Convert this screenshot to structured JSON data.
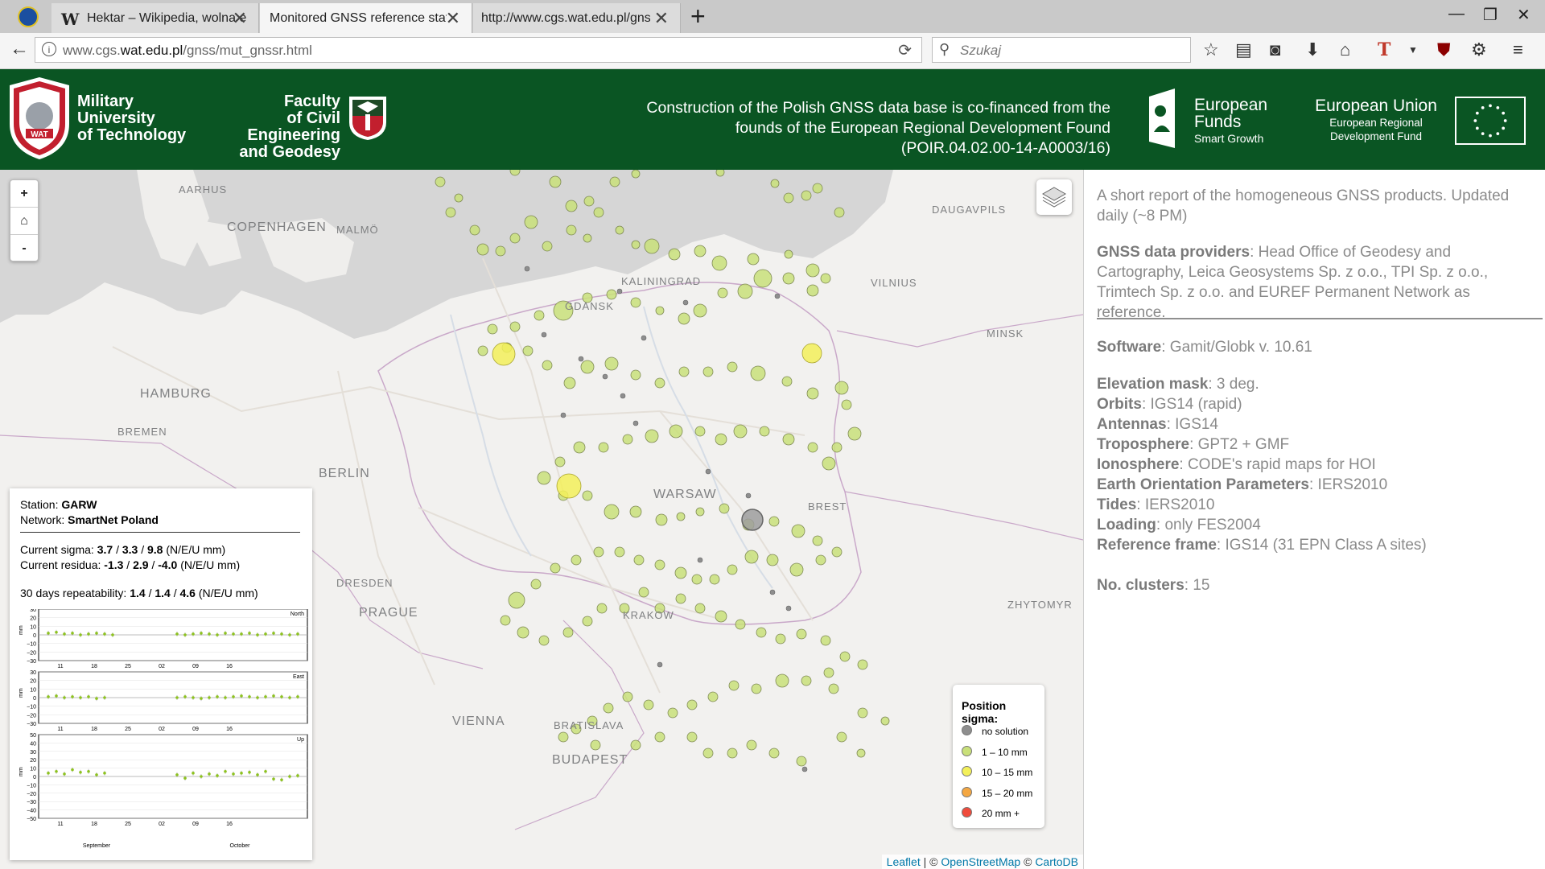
{
  "browser": {
    "tabs": [
      {
        "title": "Hektar – Wikipedia, wolna e"
      },
      {
        "title": "Monitored GNSS reference statio"
      },
      {
        "title": "http://www.cgs.wat.edu.pl/gnss/"
      }
    ],
    "url_prefix": "www.cgs.",
    "url_domain": "wat.edu.pl",
    "url_path": "/gnss/mut_gnssr.html",
    "search_placeholder": "Szukaj"
  },
  "header": {
    "wat_line1": "Military",
    "wat_line2": "University",
    "wat_line3": "of Technology",
    "faculty_line1": "Faculty",
    "faculty_line2": "of Civil Engineering",
    "faculty_line3": "and Geodesy",
    "cofin_line1": "Construction of the Polish GNSS data base is co-financed from the",
    "cofin_line2": "founds of the European Regional Development Found",
    "cofin_line3": "(POIR.04.02.00-14-A0003/16)",
    "ef_line1": "European",
    "ef_line2": "Funds",
    "ef_line3": "Smart Growth",
    "eu_line1": "European Union",
    "eu_line2": "European Regional",
    "eu_line3": "Development Fund"
  },
  "map": {
    "zoom_in": "+",
    "home": "⌂",
    "zoom_out": "-",
    "cities": {
      "aarhus": "AARHUS",
      "copenhagen": "COPENHAGEN",
      "malmo": "MALMÖ",
      "daugavpils": "DAUGAVPILS",
      "kaliningrad": "KALININGRAD",
      "vilnius": "VILNIUS",
      "gdansk": "GDANSK",
      "minsk": "MINSK",
      "hamburg": "HAMBURG",
      "bremen": "BREMEN",
      "berlin": "BERLIN",
      "warsaw": "WARSAW",
      "brest": "BREST",
      "dresden": "DRESDEN",
      "prague": "PRAGUE",
      "krakow": "KRAKOW",
      "zhytomyr": "ZHYTOMYR",
      "vienna": "VIENNA",
      "bratislava": "BRATISLAVA",
      "budapest": "BUDAPEST"
    },
    "attribution": {
      "leaflet": "Leaflet",
      "osm": "OpenStreetMap",
      "carto": "CartoDB",
      "sep1": "|",
      "copy1": "©",
      "copy2": "©"
    }
  },
  "station": {
    "station_label": "Station:",
    "station_name": "GARW",
    "network_label": "Network:",
    "network_name": "SmartNet Poland",
    "sigma_label": "Current sigma:",
    "sigma_n": "3.7",
    "sigma_e": "3.3",
    "sigma_u": "9.8",
    "sigma_unit": "(N/E/U mm)",
    "residua_label": "Current residua:",
    "residua_n": "-1.3",
    "residua_e": "2.9",
    "residua_u": "-4.0",
    "residua_unit": "(N/E/U mm)",
    "repeat_label": "30 days repeatability:",
    "repeat_n": "1.4",
    "repeat_e": "1.4",
    "repeat_u": "4.6",
    "repeat_unit": "(N/E/U mm)",
    "slash": "/",
    "plots": {
      "north": "North",
      "east": "East",
      "up": "Up",
      "ylabel": "mm",
      "yticks_small": [
        "30",
        "20",
        "10",
        "0",
        "−10",
        "−20",
        "−30"
      ],
      "yticks_up": [
        "50",
        "40",
        "30",
        "20",
        "10",
        "0",
        "−10",
        "−20",
        "−30",
        "−40",
        "−50"
      ],
      "xticks": [
        "11",
        "18",
        "25",
        "02",
        "09",
        "16"
      ],
      "month_sep": "September",
      "month_oct": "October"
    }
  },
  "legend": {
    "title": "Position sigma:",
    "items": [
      {
        "label": "no solution",
        "color": "#8e8e8e"
      },
      {
        "label": "1 – 10 mm",
        "color": "#c9e07a"
      },
      {
        "label": "10 – 15 mm",
        "color": "#f3f05a"
      },
      {
        "label": "15 – 20 mm",
        "color": "#f4a742"
      },
      {
        "label": "20 mm +",
        "color": "#ef4b3c"
      }
    ]
  },
  "side": {
    "intro": "A short report of the homogeneous GNSS products. Updated daily (~8 PM)",
    "providers_label": "GNSS data providers",
    "providers_text": ": Head Office of Geodesy and Cartography, Leica Geosystems Sp. z o.o., TPI Sp. z o.o., Trimtech Sp. z o.o. and EUREF Permanent Network as reference.",
    "software_label": "Software",
    "software_text": ": Gamit/Globk v. 10.61",
    "elev_label": "Elevation mask",
    "elev_text": ": 3 deg.",
    "orbits_label": "Orbits",
    "orbits_text": ": IGS14 (rapid)",
    "antennas_label": "Antennas",
    "antennas_text": ": IGS14",
    "tropo_label": "Troposphere",
    "tropo_text": ": GPT2 + GMF",
    "iono_label": "Ionosphere",
    "iono_text": ": CODE's rapid maps for HOI",
    "eop_label": "Earth Orientation Parameters",
    "eop_text": ": IERS2010",
    "tides_label": "Tides",
    "tides_text": ": IERS2010",
    "loading_label": "Loading",
    "loading_text": ": only FES2004",
    "ref_label": "Reference frame",
    "ref_text": ": IGS14 (31 EPN Class A sites)",
    "clusters_label": "No. clusters",
    "clusters_text": ": 15"
  }
}
